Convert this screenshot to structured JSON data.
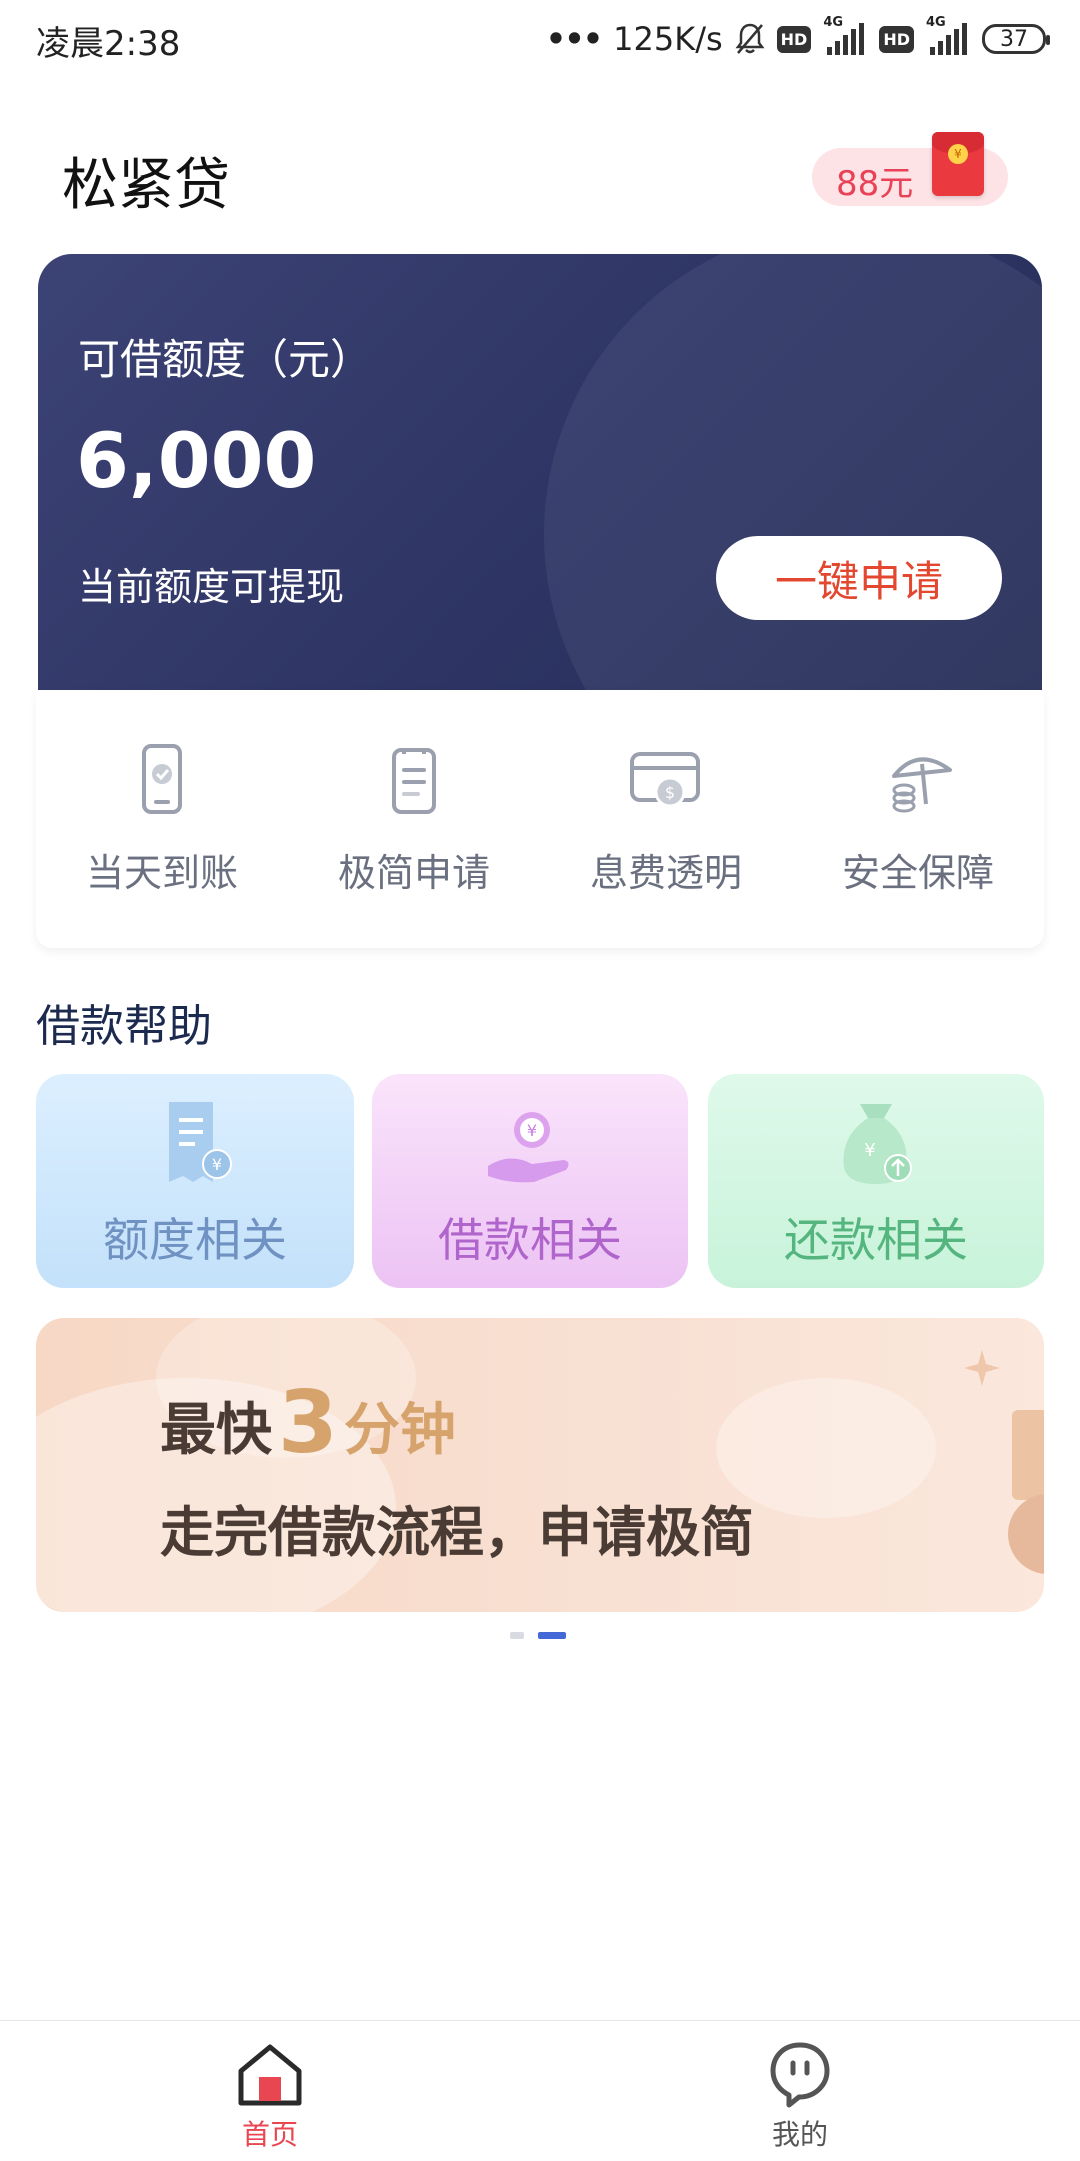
{
  "status_bar": {
    "time": "凌晨2:38",
    "net_speed": "125K/s",
    "hd1": "HD",
    "sig1_label": "4G",
    "hd2": "HD",
    "sig2_label": "4G",
    "battery": "37"
  },
  "header": {
    "title": "松紧贷",
    "red_packet": "88元"
  },
  "credit_card": {
    "label": "可借额度（元）",
    "amount": "6,000",
    "sub": "当前额度可提现",
    "apply_button": "一键申请"
  },
  "features": [
    {
      "label": "当天到账",
      "icon": "phone-check-icon"
    },
    {
      "label": "极简申请",
      "icon": "clipboard-icon"
    },
    {
      "label": "息费透明",
      "icon": "card-dollar-icon"
    },
    {
      "label": "安全保障",
      "icon": "umbrella-coins-icon"
    }
  ],
  "help": {
    "title": "借款帮助",
    "items": [
      {
        "label": "额度相关",
        "icon": "document-yuan-icon"
      },
      {
        "label": "借款相关",
        "icon": "hand-yuan-icon"
      },
      {
        "label": "还款相关",
        "icon": "money-bag-icon"
      }
    ]
  },
  "banner": {
    "line1_prefix": "最快",
    "line1_number": "3",
    "line1_suffix": "分钟",
    "line2": "走完借款流程，申请极简"
  },
  "pager": {
    "count": 2,
    "active": 2
  },
  "tab_bar": {
    "items": [
      {
        "label": "首页",
        "icon": "home-icon",
        "active": true
      },
      {
        "label": "我的",
        "icon": "profile-face-icon",
        "active": false
      }
    ]
  },
  "colors": {
    "card_bg": "#2e3564",
    "accent_red": "#e3472f",
    "tab_active": "#e84752",
    "pager_active": "#4568d9"
  }
}
